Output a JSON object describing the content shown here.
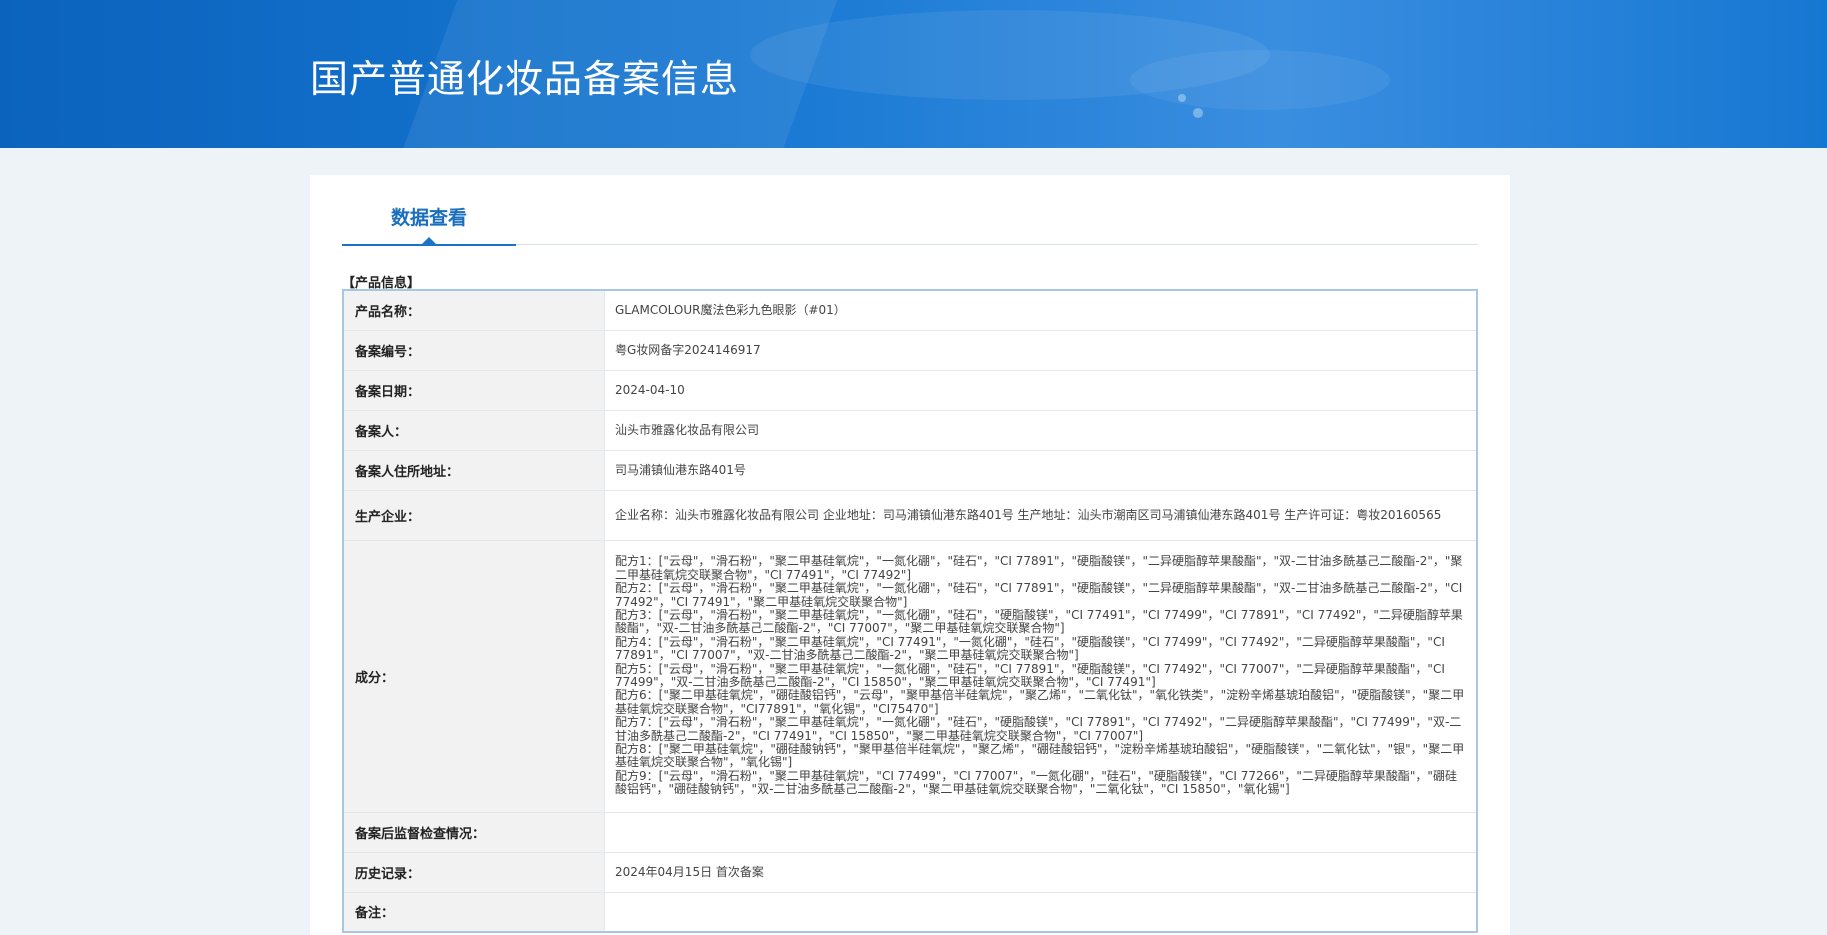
{
  "header": {
    "title": "国产普通化妆品备案信息"
  },
  "tabs": [
    {
      "label": "数据查看",
      "active": true
    }
  ],
  "section": {
    "title": "【产品信息】"
  },
  "rows": {
    "product_name": {
      "key": "产品名称：",
      "value": "GLAMCOLOUR魔法色彩九色眼影（#01）"
    },
    "record_no": {
      "key": "备案编号：",
      "value": "粤G妆网备字2024146917"
    },
    "record_date": {
      "key": "备案日期：",
      "value": "2024-04-10"
    },
    "registrant": {
      "key": "备案人：",
      "value": "汕头市雅露化妆品有限公司"
    },
    "registrant_address": {
      "key": "备案人住所地址：",
      "value": "司马浦镇仙港东路401号"
    },
    "manufacturer": {
      "key": "生产企业：",
      "value": "企业名称：汕头市雅露化妆品有限公司 企业地址：司马浦镇仙港东路401号 生产地址：汕头市潮南区司马浦镇仙港东路401号 生产许可证：粤妆20160565"
    },
    "ingredients": {
      "key": "成分：",
      "formulas": [
        "配方1：[\"云母\"，\"滑石粉\"，\"聚二甲基硅氧烷\"，\"一氮化硼\"，\"硅石\"，\"CI 77891\"，\"硬脂酸镁\"，\"二异硬脂醇苹果酸酯\"，\"双-二甘油多酰基己二酸酯-2\"，\"聚二甲基硅氧烷交联聚合物\"，\"CI 77491\"，\"CI 77492\"]",
        "配方2：[\"云母\"，\"滑石粉\"，\"聚二甲基硅氧烷\"，\"一氮化硼\"，\"硅石\"，\"CI 77891\"，\"硬脂酸镁\"，\"二异硬脂醇苹果酸酯\"，\"双-二甘油多酰基己二酸酯-2\"，\"CI 77492\"，\"CI 77491\"，\"聚二甲基硅氧烷交联聚合物\"]",
        "配方3：[\"云母\"，\"滑石粉\"，\"聚二甲基硅氧烷\"，\"一氮化硼\"，\"硅石\"，\"硬脂酸镁\"，\"CI 77491\"，\"CI 77499\"，\"CI 77891\"，\"CI 77492\"，\"二异硬脂醇苹果酸酯\"，\"双-二甘油多酰基己二酸酯-2\"，\"CI 77007\"，\"聚二甲基硅氧烷交联聚合物\"]",
        "配方4：[\"云母\"，\"滑石粉\"，\"聚二甲基硅氧烷\"，\"CI 77491\"，\"一氮化硼\"，\"硅石\"，\"硬脂酸镁\"，\"CI 77499\"，\"CI 77492\"，\"二异硬脂醇苹果酸酯\"，\"CI 77891\"，\"CI 77007\"，\"双-二甘油多酰基己二酸酯-2\"，\"聚二甲基硅氧烷交联聚合物\"]",
        "配方5：[\"云母\"，\"滑石粉\"，\"聚二甲基硅氧烷\"，\"一氮化硼\"，\"硅石\"，\"CI 77891\"，\"硬脂酸镁\"，\"CI 77492\"，\"CI 77007\"，\"二异硬脂醇苹果酸酯\"，\"CI 77499\"，\"双-二甘油多酰基己二酸酯-2\"，\"CI 15850\"，\"聚二甲基硅氧烷交联聚合物\"，\"CI 77491\"]",
        "配方6：[\"聚二甲基硅氧烷\"，\"硼硅酸铝钙\"，\"云母\"，\"聚甲基倍半硅氧烷\"，\"聚乙烯\"，\"二氧化钛\"，\"氧化铁类\"，\"淀粉辛烯基琥珀酸铝\"，\"硬脂酸镁\"，\"聚二甲基硅氧烷交联聚合物\"，\"CI77891\"，\"氧化锡\"，\"CI75470\"]",
        "配方7：[\"云母\"，\"滑石粉\"，\"聚二甲基硅氧烷\"，\"一氮化硼\"，\"硅石\"，\"硬脂酸镁\"，\"CI 77891\"，\"CI 77492\"，\"二异硬脂醇苹果酸酯\"，\"CI 77499\"，\"双-二甘油多酰基己二酸酯-2\"，\"CI 77491\"，\"CI 15850\"，\"聚二甲基硅氧烷交联聚合物\"，\"CI 77007\"]",
        "配方8：[\"聚二甲基硅氧烷\"，\"硼硅酸钠钙\"，\"聚甲基倍半硅氧烷\"，\"聚乙烯\"，\"硼硅酸铝钙\"，\"淀粉辛烯基琥珀酸铝\"，\"硬脂酸镁\"，\"二氧化钛\"，\"银\"，\"聚二甲基硅氧烷交联聚合物\"，\"氧化锡\"]",
        "配方9：[\"云母\"，\"滑石粉\"，\"聚二甲基硅氧烷\"，\"CI 77499\"，\"CI 77007\"，\"一氮化硼\"，\"硅石\"，\"硬脂酸镁\"，\"CI 77266\"，\"二异硬脂醇苹果酸酯\"，\"硼硅酸铝钙\"，\"硼硅酸钠钙\"，\"双-二甘油多酰基己二酸酯-2\"，\"聚二甲基硅氧烷交联聚合物\"，\"二氧化钛\"，\"CI 15850\"，\"氧化锡\"]"
      ]
    },
    "inspection": {
      "key": "备案后监督检查情况：",
      "value": ""
    },
    "history": {
      "key": "历史记录：",
      "value": "2024年04月15日 首次备案"
    },
    "remarks": {
      "key": "备注：",
      "value": ""
    }
  },
  "colors": {
    "banner": "#1677d2",
    "accent": "#1a6fbd",
    "table_border": "#a9c6e2",
    "key_bg": "#f2f2f2"
  }
}
